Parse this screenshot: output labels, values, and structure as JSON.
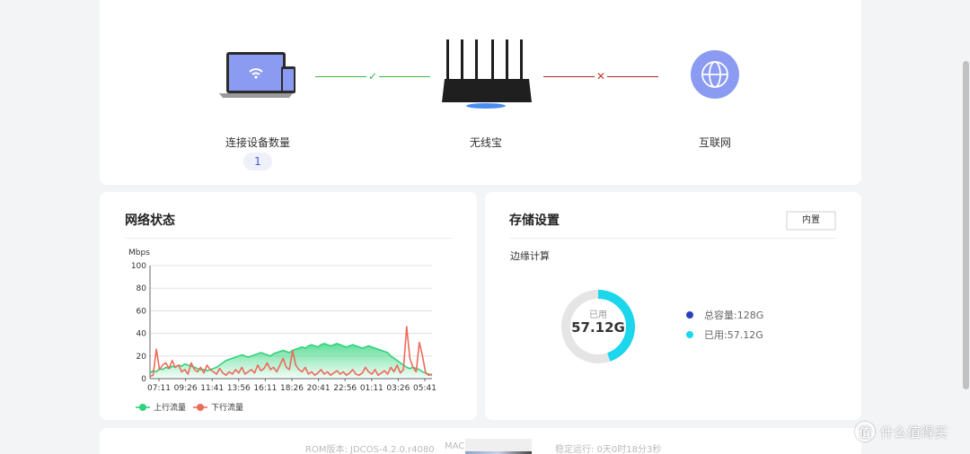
{
  "topology": {
    "devices_label": "连接设备数量",
    "devices_count": "1",
    "router_label": "无线宝",
    "internet_label": "互联网",
    "left_link_status_icon": "check-icon",
    "right_link_status_icon": "cross-icon",
    "left_link_color": "#3cb44b",
    "right_link_color": "#b22222",
    "internet_icon_color": "#8b9bf2"
  },
  "network": {
    "title": "网络状态"
  },
  "chart_data": {
    "type": "area",
    "ylabel": "Mbps",
    "ylim": [
      0,
      100
    ],
    "yticks": [
      0,
      20,
      40,
      60,
      80,
      100
    ],
    "x_tick_labels": [
      "07:11",
      "09:26",
      "11:41",
      "13:56",
      "16:11",
      "18:26",
      "20:41",
      "22:56",
      "01:11",
      "03:26",
      "05:41"
    ],
    "grid": true,
    "legend": "bottom-left",
    "series": [
      {
        "name": "上行流量",
        "color": "#2fd37a",
        "values": [
          5,
          7,
          6,
          9,
          8,
          10,
          9,
          11,
          10,
          12,
          11,
          13,
          12,
          11,
          10,
          9,
          8,
          8,
          7,
          8,
          9,
          10,
          12,
          14,
          16,
          17,
          18,
          19,
          20,
          21,
          20,
          19,
          20,
          21,
          22,
          23,
          22,
          21,
          20,
          22,
          23,
          24,
          25,
          24,
          23,
          25,
          26,
          27,
          28,
          27,
          29,
          30,
          29,
          28,
          30,
          31,
          30,
          29,
          30,
          31,
          30,
          29,
          28,
          29,
          30,
          29,
          28,
          27,
          28,
          29,
          28,
          27,
          26,
          25,
          24,
          23,
          20,
          18,
          16,
          14,
          12,
          10,
          9,
          10,
          9,
          8,
          6,
          5,
          4,
          3
        ]
      },
      {
        "name": "下行流量",
        "color": "#ee6a5a",
        "values": [
          2,
          3,
          26,
          8,
          12,
          14,
          9,
          16,
          10,
          12,
          6,
          8,
          4,
          14,
          8,
          6,
          10,
          5,
          12,
          8,
          6,
          4,
          9,
          5,
          3,
          6,
          4,
          8,
          5,
          10,
          4,
          6,
          8,
          5,
          12,
          7,
          9,
          14,
          8,
          10,
          6,
          12,
          18,
          10,
          8,
          25,
          12,
          8,
          6,
          10,
          4,
          6,
          3,
          5,
          8,
          4,
          6,
          3,
          5,
          7,
          4,
          6,
          3,
          5,
          8,
          4,
          3,
          5,
          10,
          6,
          4,
          8,
          3,
          5,
          7,
          4,
          10,
          6,
          12,
          5,
          8,
          46,
          18,
          10,
          6,
          32,
          20,
          5,
          3,
          4
        ]
      }
    ]
  },
  "storage": {
    "title": "存储设置",
    "builtin_button": "内置",
    "subtitle": "边缘计算",
    "used_label": "已用",
    "used_value": "57.12G",
    "used_fraction": 0.446,
    "ring_used_color": "#1cd6ec",
    "ring_track_color": "#e5e5e5",
    "legend": [
      {
        "label": "总容量:128G",
        "color": "#2a3fbe"
      },
      {
        "label": "已用:57.12G",
        "color": "#1cd6ec"
      }
    ]
  },
  "footer": {
    "rom_version": "ROM版本: JDCOS-4.2.0.r4080",
    "mac_label": "MAC:",
    "uptime": "稳定运行: 0天0时18分3秒"
  },
  "watermark": {
    "logo_text": "值",
    "text": "什么值得买"
  }
}
